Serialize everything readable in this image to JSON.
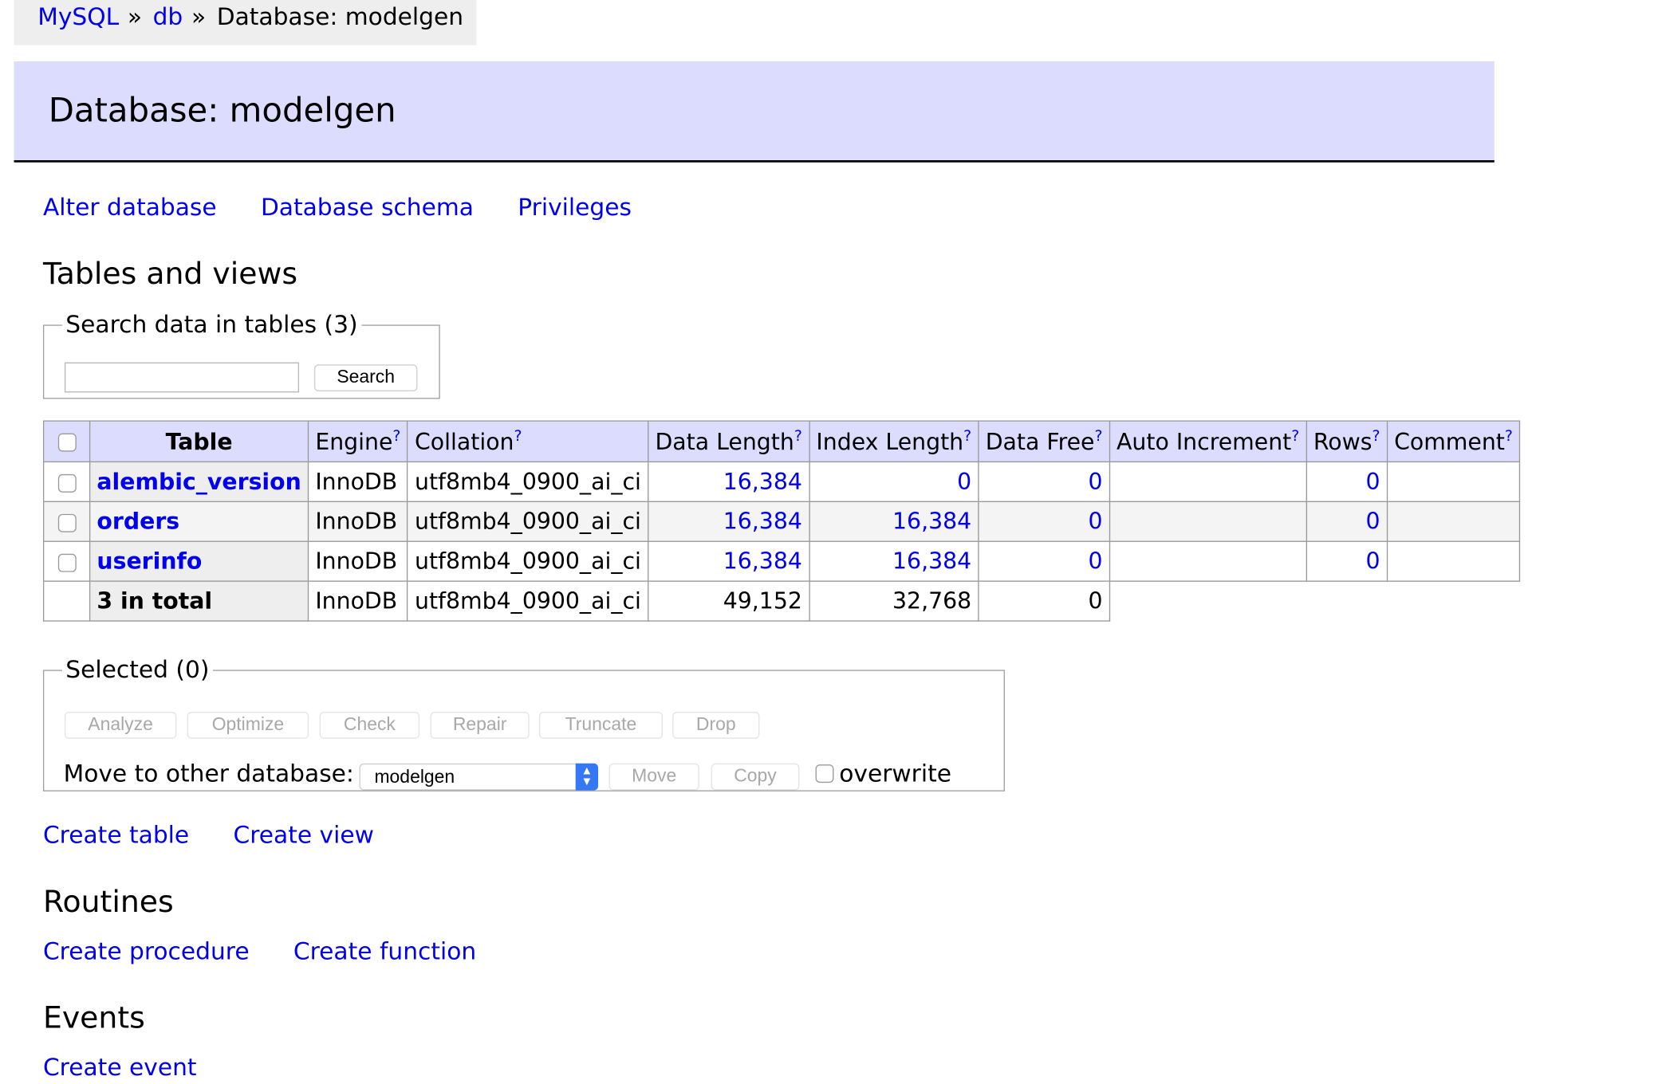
{
  "breadcrumb": {
    "items": [
      "MySQL",
      "db"
    ],
    "current": "Database: modelgen",
    "separator": "»"
  },
  "header": {
    "title": "Database: modelgen"
  },
  "top_links": [
    "Alter database",
    "Database schema",
    "Privileges"
  ],
  "tables_section": {
    "heading": "Tables and views",
    "search": {
      "legend": "Search data in tables (3)",
      "value": "",
      "button": "Search"
    },
    "columns": {
      "table": "Table",
      "engine": "Engine",
      "collation": "Collation",
      "data_length": "Data Length",
      "index_length": "Index Length",
      "data_free": "Data Free",
      "auto_increment": "Auto Increment",
      "rows": "Rows",
      "comment": "Comment",
      "help": "?"
    },
    "rows": [
      {
        "name": "alembic_version",
        "engine": "InnoDB",
        "collation": "utf8mb4_0900_ai_ci",
        "data_length": "16,384",
        "index_length": "0",
        "data_free": "0",
        "auto_increment": "",
        "rows": "0",
        "comment": ""
      },
      {
        "name": "orders",
        "engine": "InnoDB",
        "collation": "utf8mb4_0900_ai_ci",
        "data_length": "16,384",
        "index_length": "16,384",
        "data_free": "0",
        "auto_increment": "",
        "rows": "0",
        "comment": ""
      },
      {
        "name": "userinfo",
        "engine": "InnoDB",
        "collation": "utf8mb4_0900_ai_ci",
        "data_length": "16,384",
        "index_length": "16,384",
        "data_free": "0",
        "auto_increment": "",
        "rows": "0",
        "comment": ""
      }
    ],
    "total": {
      "label": "3 in total",
      "engine": "InnoDB",
      "collation": "utf8mb4_0900_ai_ci",
      "data_length": "49,152",
      "index_length": "32,768",
      "data_free": "0"
    }
  },
  "selected": {
    "legend": "Selected (0)",
    "buttons": [
      "Analyze",
      "Optimize",
      "Check",
      "Repair",
      "Truncate",
      "Drop"
    ],
    "move_label": "Move to other database:",
    "database_select": "modelgen",
    "move_button": "Move",
    "copy_button": "Copy",
    "overwrite_label": "overwrite"
  },
  "create_links": [
    "Create table",
    "Create view"
  ],
  "routines": {
    "heading": "Routines",
    "links": [
      "Create procedure",
      "Create function"
    ]
  },
  "events": {
    "heading": "Events",
    "links": [
      "Create event"
    ]
  }
}
